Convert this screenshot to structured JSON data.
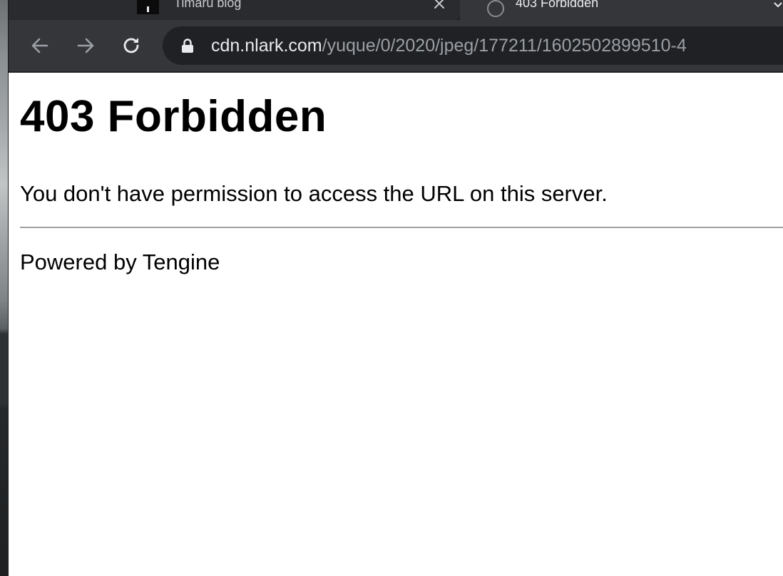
{
  "browser": {
    "tabs": [
      {
        "title": "Timaru blog",
        "favicon": "timaru-favicon",
        "active": false
      },
      {
        "title": "403 Forbidden",
        "favicon": "globe-icon",
        "active": true
      }
    ],
    "nav": {
      "back": "arrow-left-icon",
      "forward": "arrow-right-icon",
      "reload": "reload-icon"
    },
    "address_bar": {
      "lock_icon": "lock-icon",
      "host": "cdn.nlark.com",
      "path": "/yuque/0/2020/jpeg/177211/1602502899510-4"
    }
  },
  "page": {
    "heading": "403 Forbidden",
    "message": "You don't have permission to access the URL on this server.",
    "footer": "Powered by Tengine"
  },
  "colors": {
    "tabstrip": "#202124",
    "toolbar": "#35363a",
    "omnibox": "#202124",
    "url_host": "#e8eaed",
    "url_path": "#9aa0a6",
    "page_background": "#ffffff"
  }
}
